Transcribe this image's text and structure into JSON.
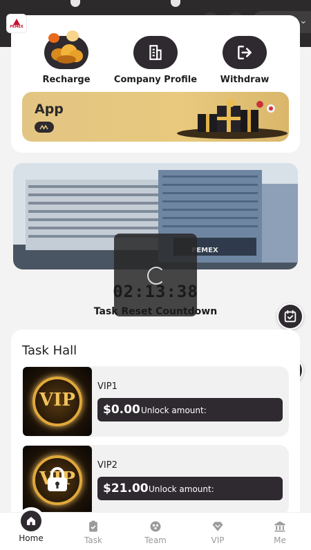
{
  "header": {
    "brand_logo_text": "PEMEX"
  },
  "quick_actions": [
    {
      "label": "Recharge",
      "icon": "coins-icon"
    },
    {
      "label": "Company Profile",
      "icon": "building-icon"
    },
    {
      "label": "Withdraw",
      "icon": "withdraw-icon"
    }
  ],
  "app_banner": {
    "title": "App",
    "badge_icon": "double-chevron-icon"
  },
  "hero": {
    "sign_text": "PEMEX"
  },
  "countdown": {
    "time": "02:13:38",
    "label": "Task Reset Countdown"
  },
  "task_hall": {
    "title": "Task Hall",
    "items": [
      {
        "name": "VIP1",
        "amount": "$0.00",
        "amount_label": "Unlock amount:",
        "locked": false,
        "thumb_text": "VIP"
      },
      {
        "name": "VIP2",
        "amount": "$21.00",
        "amount_label": "Unlock amount:",
        "locked": true,
        "thumb_text": "VIP"
      }
    ]
  },
  "floating_buttons": [
    {
      "icon": "calendar-check-icon"
    },
    {
      "icon": "gift-icon"
    }
  ],
  "bottom_nav": [
    {
      "label": "Home",
      "icon": "home-icon",
      "active": true
    },
    {
      "label": "Task",
      "icon": "task-icon",
      "active": false
    },
    {
      "label": "Team",
      "icon": "team-icon",
      "active": false
    },
    {
      "label": "VIP",
      "icon": "vip-diamond-icon",
      "active": false
    },
    {
      "label": "Me",
      "icon": "bank-icon",
      "active": false
    }
  ],
  "colors": {
    "dark": "#2e2a2f",
    "banner_gold": "#e3c583",
    "background": "#f3f3f3",
    "inactive_nav": "#9a9a9a"
  }
}
